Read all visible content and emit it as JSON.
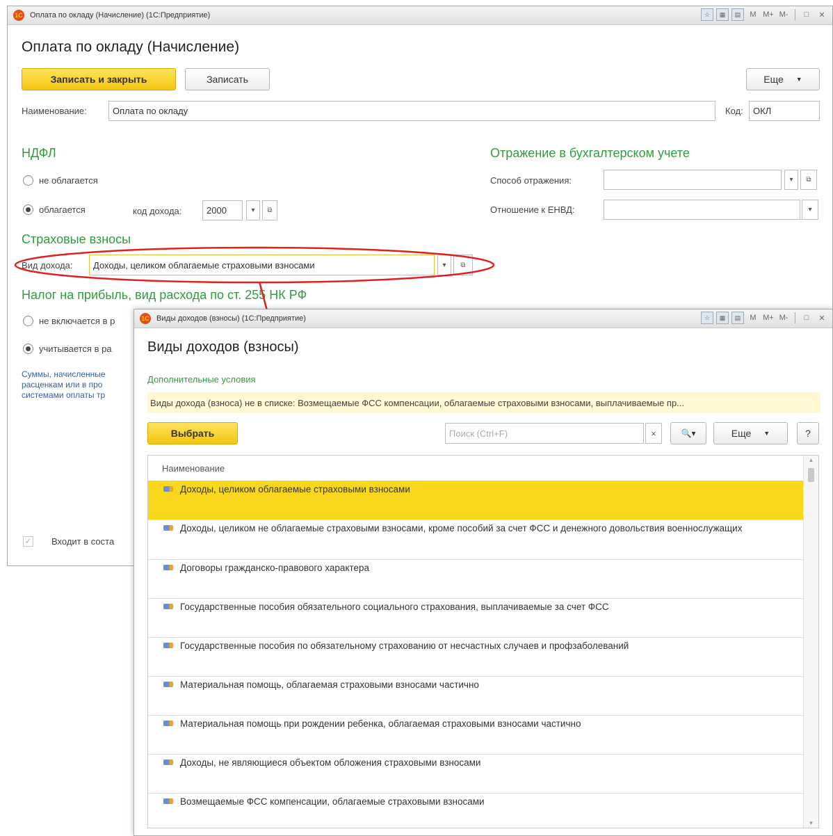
{
  "main": {
    "window_title": "Оплата по окладу (Начисление) (1С:Предприятие)",
    "form_title": "Оплата по окладу (Начисление)",
    "save_close_label": "Записать и закрыть",
    "save_label": "Записать",
    "more_label": "Еще",
    "name_label": "Наименование:",
    "name_value": "Оплата по окладу",
    "code_label": "Код:",
    "code_value": "ОКЛ",
    "ndfl_title": "НДФЛ",
    "ndfl_option1": "не облагается",
    "ndfl_option2": "облагается",
    "income_code_label": "код дохода:",
    "income_code_value": "2000",
    "accounting_title": "Отражение в бухгалтерском учете",
    "reflection_method_label": "Способ отражения:",
    "envd_label": "Отношение к ЕНВД:",
    "insurance_title": "Страховые взносы",
    "income_type_label": "Вид дохода:",
    "income_type_value": "Доходы, целиком облагаемые страховыми взносами",
    "profit_tax_title": "Налог на прибыль, вид расхода по ст. 255 НК РФ",
    "profit_option1": "не включается в р",
    "profit_option2": "учитывается в ра",
    "note_line1": "Суммы, начисленные",
    "note_line2": "расценкам или в про",
    "note_line3": "системами оплаты тр",
    "included_label": "Входит в соста",
    "title_buttons": [
      "M",
      "M+",
      "M-",
      "□",
      "✕"
    ]
  },
  "popup": {
    "window_title": "Виды доходов (взносы) (1С:Предприятие)",
    "form_title": "Виды доходов (взносы)",
    "extra_conditions_label": "Дополнительные условия",
    "info_text": "Виды дохода (взноса) не в списке: Возмещаемые ФСС компенсации, облагаемые страховыми взносами, выплачиваемые пр...",
    "select_label": "Выбрать",
    "search_placeholder": "Поиск (Ctrl+F)",
    "clear_glyph": "×",
    "search_glyph": "🔍▾",
    "more_label": "Еще",
    "help_label": "?",
    "column_header": "Наименование",
    "items": [
      "Доходы, целиком облагаемые страховыми взносами",
      "Доходы, целиком не облагаемые страховыми взносами, кроме пособий за счет ФСС и денежного довольствия военнослужащих",
      "Договоры гражданско-правового характера",
      "Государственные пособия обязательного социального страхования, выплачиваемые за счет ФСС",
      "Государственные пособия по обязательному страхованию от несчастных случаев и профзаболеваний",
      "Материальная помощь, облагаемая страховыми взносами частично",
      "Материальная помощь при рождении ребенка, облагаемая страховыми взносами частично",
      "Доходы, не являющиеся объектом обложения страховыми взносами",
      "Возмещаемые ФСС компенсации, облагаемые страховыми взносами"
    ],
    "title_buttons": [
      "M",
      "M+",
      "M-",
      "□",
      "✕"
    ]
  },
  "colors": {
    "accent_yellow": "#f9d71c",
    "section_green": "#2f9d3e",
    "highlight_red": "#e02020",
    "note_blue": "#3a5ea8"
  }
}
